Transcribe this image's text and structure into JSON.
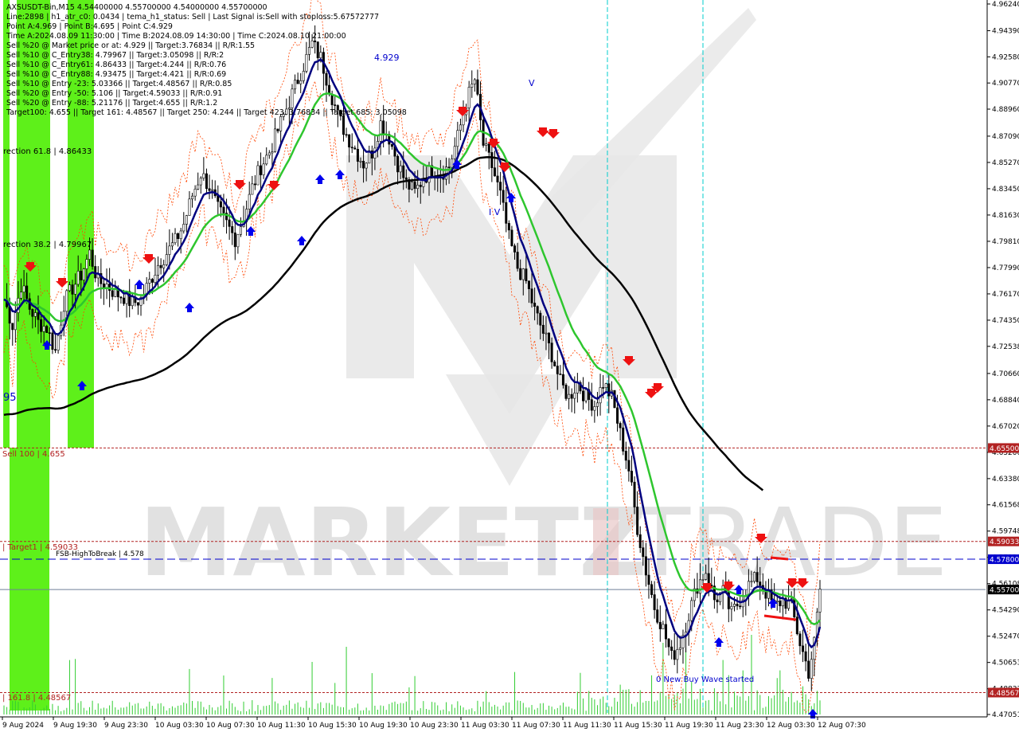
{
  "header": {
    "lines": [
      "AXSUSDT-Bin,M15  4.54400000 4.55700000 4.54000000 4.55700000",
      "Line:2898 | h1_atr_c0: 0.0434 | tema_h1_status: Sell | Last Signal is:Sell with stoploss:5.67572777",
      "Point A:4.969 | Point B:4.695 | Point C:4.929",
      "Time A:2024.08.09 11:30:00 | Time B:2024.08.09 14:30:00 | Time C:2024.08.10 21:00:00",
      "Sell %20 @ Market price or at: 4.929 || Target:3.76834 || R/R:1.55",
      "Sell %10 @ C_Entry38: 4.79967 || Target:3.05098 || R/R:2",
      "Sell %10 @ C_Entry61: 4.86433 || Target:4.244 || R/R:0.76",
      "Sell %10 @ C_Entry88: 4.93475 || Target:4.421 || R/R:0.69",
      "Sell %10 @ Entry -23: 5.03366 || Target:4.48567 || R/R:0.85",
      "Sell %20 @ Entry -50: 5.106 || Target:4.59033 || R/R:0.91",
      "Sell %20 @ Entry -88: 5.21176 || Target:4.655 || R/R:1.2",
      "Target100: 4.655 || Target 161: 4.48567 || Target 250: 4.244 || Target 423: 3.76834 || Target 685: 3.05098"
    ]
  },
  "annotations": {
    "correction618": "rection 61.8 | 4.86433",
    "correction382": "rection 38.2 | 4.79967",
    "sell100": "Sell 100 | 4.655",
    "target1": "| Target1 | 4.59033",
    "fsb": "FSB-HighToBreak | 4.578",
    "target161": "| 161.8 | 4.48567",
    "buy_wave": "0 New Buy Wave started",
    "point_label": "4.929",
    "partial95": "95",
    "roman_iv": "I V",
    "roman_v": "V"
  },
  "watermark": {
    "left": "MARKETZ",
    "right": "TRADE"
  },
  "colors": {
    "sell_line": "#b22222",
    "target_line": "#b22222",
    "fsb_line": "#0000cd",
    "current_price": "#6f7f99",
    "ema_fast": "#00007f",
    "ema_mid": "#2ec62e",
    "ema_slow": "#000000",
    "green_zone": "#5ef01a",
    "cyan_vline": "#00cccc",
    "candle": "#000000",
    "band": "#ff4500",
    "volume": "#32cd32"
  },
  "chart_data": {
    "type": "candlestick",
    "symbol": "AXSUSDT-Bin",
    "timeframe": "M15",
    "ylim": [
      4.4705,
      4.9624
    ],
    "y_ticks": [
      "4.96240",
      "4.94390",
      "4.92580",
      "4.90770",
      "4.88960",
      "4.87090",
      "4.85270",
      "4.83450",
      "4.81630",
      "4.79810",
      "4.77990",
      "4.76170",
      "4.74350",
      "4.72538",
      "4.70660",
      "4.68840",
      "4.67020",
      "4.65200",
      "4.63380",
      "4.61568",
      "4.59748",
      "4.57928",
      "4.56108",
      "4.54290",
      "4.52470",
      "4.50653",
      "4.48833",
      "4.47051"
    ],
    "x_ticks": [
      "9 Aug 2024",
      "9 Aug 19:30",
      "9 Aug 23:30",
      "10 Aug 03:30",
      "10 Aug 07:30",
      "10 Aug 11:30",
      "10 Aug 15:30",
      "10 Aug 19:30",
      "10 Aug 23:30",
      "11 Aug 03:30",
      "11 Aug 07:30",
      "11 Aug 11:30",
      "11 Aug 15:30",
      "11 Aug 19:30",
      "11 Aug 23:30",
      "12 Aug 03:30",
      "12 Aug 07:30"
    ],
    "price_labels": [
      {
        "text": "4.65500",
        "value": 4.655,
        "color": "#b22222"
      },
      {
        "text": "4.59033",
        "value": 4.59033,
        "color": "#b22222"
      },
      {
        "text": "4.57800",
        "value": 4.578,
        "color": "#0000cd"
      },
      {
        "text": "4.55700",
        "value": 4.557,
        "color": "#000000"
      },
      {
        "text": "4.48567",
        "value": 4.48567,
        "color": "#b22222"
      }
    ],
    "close_path": [
      [
        0,
        4.758
      ],
      [
        3,
        4.74
      ],
      [
        6,
        4.768
      ],
      [
        9,
        4.752
      ],
      [
        12,
        4.742
      ],
      [
        15,
        4.738
      ],
      [
        18,
        4.722
      ],
      [
        21,
        4.755
      ],
      [
        24,
        4.766
      ],
      [
        27,
        4.775
      ],
      [
        30,
        4.79
      ],
      [
        33,
        4.77
      ],
      [
        36,
        4.768
      ],
      [
        39,
        4.762
      ],
      [
        42,
        4.76
      ],
      [
        45,
        4.755
      ],
      [
        48,
        4.758
      ],
      [
        51,
        4.77
      ],
      [
        54,
        4.782
      ],
      [
        57,
        4.79
      ],
      [
        60,
        4.798
      ],
      [
        63,
        4.81
      ],
      [
        66,
        4.83
      ],
      [
        69,
        4.845
      ],
      [
        72,
        4.836
      ],
      [
        75,
        4.82
      ],
      [
        78,
        4.81
      ],
      [
        81,
        4.8
      ],
      [
        84,
        4.815
      ],
      [
        87,
        4.835
      ],
      [
        90,
        4.85
      ],
      [
        93,
        4.86
      ],
      [
        96,
        4.875
      ],
      [
        99,
        4.89
      ],
      [
        102,
        4.905
      ],
      [
        105,
        4.92
      ],
      [
        108,
        4.935
      ],
      [
        111,
        4.925
      ],
      [
        114,
        4.905
      ],
      [
        117,
        4.885
      ],
      [
        120,
        4.872
      ],
      [
        123,
        4.862
      ],
      [
        126,
        4.852
      ],
      [
        129,
        4.86
      ],
      [
        132,
        4.88
      ],
      [
        135,
        4.87
      ],
      [
        138,
        4.852
      ],
      [
        141,
        4.838
      ],
      [
        144,
        4.832
      ],
      [
        147,
        4.842
      ],
      [
        150,
        4.848
      ],
      [
        153,
        4.845
      ],
      [
        156,
        4.85
      ],
      [
        159,
        4.87
      ],
      [
        162,
        4.895
      ],
      [
        165,
        4.91
      ],
      [
        168,
        4.865
      ],
      [
        171,
        4.85
      ],
      [
        174,
        4.83
      ],
      [
        177,
        4.8
      ],
      [
        180,
        4.78
      ],
      [
        183,
        4.77
      ],
      [
        186,
        4.75
      ],
      [
        189,
        4.735
      ],
      [
        192,
        4.72
      ],
      [
        195,
        4.7
      ],
      [
        198,
        4.69
      ],
      [
        201,
        4.7
      ],
      [
        204,
        4.69
      ],
      [
        207,
        4.685
      ],
      [
        210,
        4.7
      ],
      [
        213,
        4.69
      ],
      [
        216,
        4.665
      ],
      [
        219,
        4.64
      ],
      [
        222,
        4.6
      ],
      [
        225,
        4.57
      ],
      [
        228,
        4.545
      ],
      [
        231,
        4.53
      ],
      [
        234,
        4.51
      ],
      [
        237,
        4.52
      ],
      [
        240,
        4.54
      ],
      [
        243,
        4.56
      ],
      [
        246,
        4.57
      ],
      [
        249,
        4.55
      ],
      [
        252,
        4.555
      ],
      [
        255,
        4.54
      ],
      [
        258,
        4.55
      ],
      [
        261,
        4.56
      ],
      [
        264,
        4.565
      ],
      [
        267,
        4.555
      ],
      [
        270,
        4.545
      ],
      [
        273,
        4.55
      ],
      [
        276,
        4.545
      ],
      [
        279,
        4.52
      ],
      [
        282,
        4.5
      ],
      [
        284,
        4.52
      ],
      [
        286,
        4.557
      ]
    ]
  }
}
